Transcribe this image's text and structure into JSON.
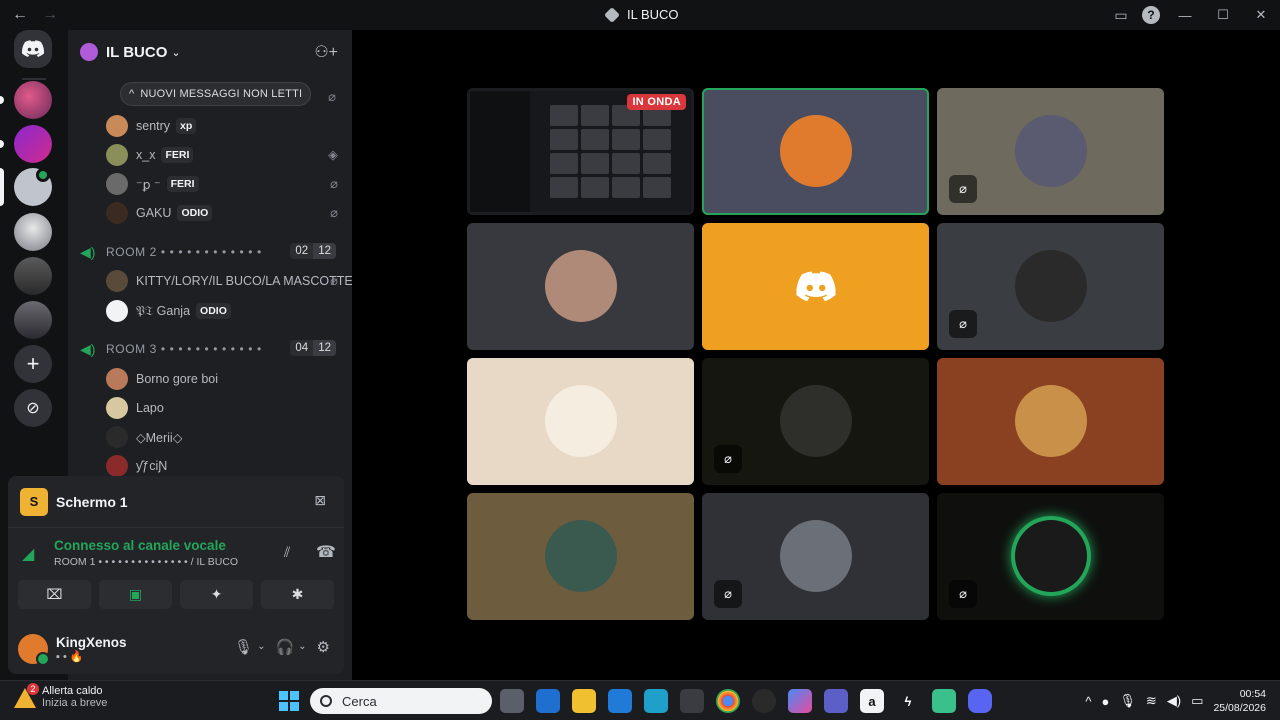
{
  "titlebar": {
    "title": "IL BUCO",
    "back": "←",
    "forward": "→"
  },
  "server": {
    "name": "IL BUCO",
    "chevron": "⌄"
  },
  "unread_banner": {
    "arrow": "^",
    "label": "NUOVI MESSAGGI NON LETTI"
  },
  "room1_users": [
    {
      "name": "sentry",
      "tag": "xp",
      "avatar_color": "#c98a5a"
    },
    {
      "name": "x_x",
      "tag": "FERI",
      "avatar_color": "#8a8f5a"
    },
    {
      "name": "⁻ꝑ ⁻",
      "tag": "FERI",
      "avatar_color": "#6a6a6a"
    },
    {
      "name": "GAKU",
      "tag": "ODIO",
      "avatar_color": "#3b2a20"
    }
  ],
  "rooms": [
    {
      "label": "ROOM 2 • • • • • • • • • • • •",
      "count": "02",
      "limit": "12"
    },
    {
      "label": "ROOM 3 • • • • • • • • • • • •",
      "count": "04",
      "limit": "12"
    }
  ],
  "room2_users": [
    {
      "name": "KITTY/LORY/IL BUCO/LA MASCOTTE",
      "avatar_color": "#5a4a3a"
    },
    {
      "name": "𝔓𝔗 Ganja",
      "tag": "ODIO",
      "avatar_color": "#f2f3f5"
    }
  ],
  "room3_users": [
    {
      "name": "Borno gore boi",
      "avatar_color": "#b87a5a"
    },
    {
      "name": "Lapo",
      "avatar_color": "#d8c8a0"
    },
    {
      "name": "◇Merii◇",
      "avatar_color": "#2a2a2a"
    },
    {
      "name": "ƴƒciƝ",
      "avatar_color": "#8a2a2a"
    }
  ],
  "stream_panel": {
    "letter": "S",
    "label": "Schermo 1"
  },
  "voice": {
    "status": "Connesso al canale vocale",
    "channel": "ROOM 1 • • • • • • • • • • • • • • / IL BUCO"
  },
  "user": {
    "name": "KingXenos",
    "status": "▪ • 🔥"
  },
  "stage": {
    "live_label": "IN ONDA"
  },
  "tiles": [
    {
      "bg": "#1c1d20",
      "kind": "stream"
    },
    {
      "bg": "#4a4d60",
      "kind": "avatar",
      "ava": "#e07b2e",
      "speaking": true
    },
    {
      "bg": "#6e6a5e",
      "kind": "avatar",
      "ava": "#5a5a70",
      "mute": true
    },
    {
      "bg": "#37393e",
      "kind": "avatar",
      "ava": "#b08a78"
    },
    {
      "bg": "#f0a020",
      "kind": "discord"
    },
    {
      "bg": "#3a3d42",
      "kind": "avatar",
      "ava": "#2a2a2a",
      "mute": true
    },
    {
      "bg": "#e7d9c6",
      "kind": "avatar",
      "ava": "#f5ede0"
    },
    {
      "bg": "#15160f",
      "kind": "avatar",
      "ava": "#2e2f2a",
      "mute": true
    },
    {
      "bg": "#8a4122",
      "kind": "avatar",
      "ava": "#c89048"
    },
    {
      "bg": "#6d5d3e",
      "kind": "avatar",
      "ava": "#3a5a50"
    },
    {
      "bg": "#303136",
      "kind": "avatar",
      "ava": "#6a6f78",
      "mute": true
    },
    {
      "bg": "#0f100e",
      "kind": "ring",
      "ava": "#1a1a1a",
      "mute": true
    }
  ],
  "taskbar": {
    "weather_count": "2",
    "weather_title": "Allerta caldo",
    "weather_sub": "Inizia a breve",
    "search_placeholder": "Cerca",
    "time": "00:54",
    "date": "25/08/2026"
  }
}
